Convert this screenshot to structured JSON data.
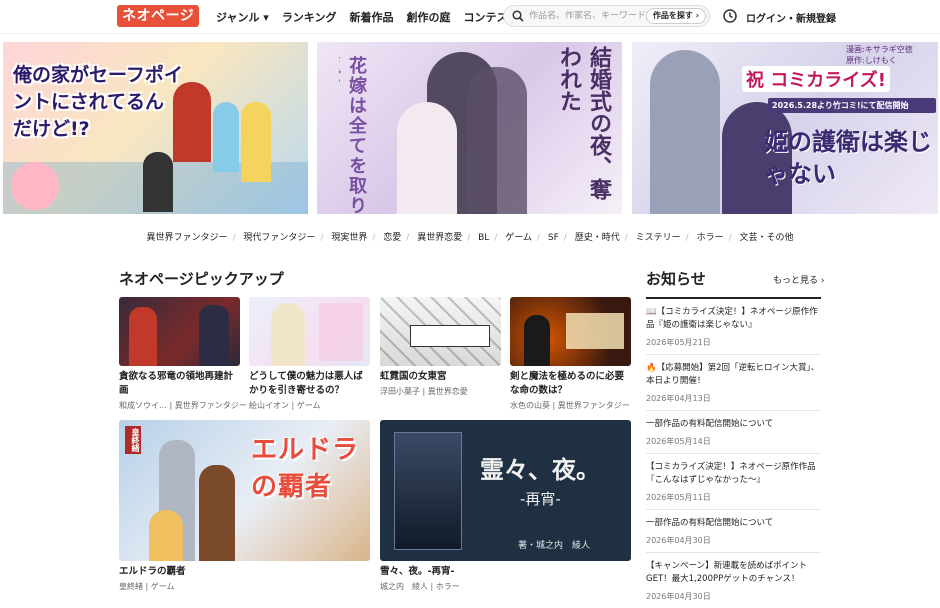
{
  "header": {
    "logo": "ネオページ",
    "nav": [
      "ジャンル ▾",
      "ランキング",
      "新着作品",
      "創作の庭",
      "コンテスト"
    ],
    "search_placeholder": "作品名、作家名、キーワードで探す",
    "search_button": "作品を探す ›",
    "login": "ログイン・新規登録"
  },
  "banners": [
    {
      "title": "俺の家がセーフポイントにされてるんだけど!?"
    },
    {
      "title": "花嫁は全てを取り返す",
      "subtitle": "結婚式の夜、奪われた"
    },
    {
      "title": "姫の護衛は楽じゃない",
      "badge": "祝 コミカライズ!",
      "note": "2026.5.28より竹コミ!にて配信開始",
      "credit_art": "漫画:キサラギ空徳",
      "credit_orig": "原作:しけもく"
    }
  ],
  "genres": [
    "異世界ファンタジー",
    "現代ファンタジー",
    "現実世界",
    "恋愛",
    "異世界恋愛",
    "BL",
    "ゲーム",
    "SF",
    "歴史・時代",
    "ミステリー",
    "ホラー",
    "文芸・その他"
  ],
  "pickup": {
    "title": "ネオページピックアップ",
    "small": [
      {
        "title": "貪欲なる邪竜の領地再建計画",
        "meta": "和成ソウイ… | 異世界ファンタジー"
      },
      {
        "title": "どうして僕の魅力は悪人ばかりを引き寄せるの？",
        "meta": "絵山イオン | ゲーム"
      },
      {
        "title": "虹霓国の女東宮",
        "meta": "浮田小葉子 | 異世界恋愛"
      },
      {
        "title": "剣と魔法を極めるのに必要な命の数は？",
        "meta": "水色の山葵 | 異世界ファンタジー"
      }
    ],
    "big": [
      {
        "title": "エルドラの覇者",
        "meta": "皇終緒 | ゲーム",
        "cover_text": "エルドラの覇者",
        "badge": "皇終緒"
      },
      {
        "title": "雪々、夜。-再宵-",
        "meta": "城之内　綾人 | ホラー",
        "cover_text": "霊々、夜。",
        "cover_sub": "-再宵-",
        "cover_author": "著・城之内　綾人"
      }
    ]
  },
  "notices": {
    "title": "お知らせ",
    "more": "もっと見る ›",
    "items": [
      {
        "text": "📖【コミカライズ決定！】ネオページ原作作品『姫の護衛は楽じゃない』",
        "date": "2026年05月21日"
      },
      {
        "text": "🔥【応募開始】第2回「逆転ヒロイン大賞」、本日より開催！",
        "date": "2026年04月13日"
      },
      {
        "text": "一部作品の有料配信開始について",
        "date": "2026年05月14日"
      },
      {
        "text": "【コミカライズ決定！】ネオページ原作作品『こんなはずじゃなかった〜』",
        "date": "2026年05月11日"
      },
      {
        "text": "一部作品の有料配信開始について",
        "date": "2026年04月30日"
      },
      {
        "text": "【キャンペーン】新連載を読めばポイントGET！最大1,200PPゲットのチャンス！",
        "date": "2026年04月30日"
      }
    ]
  }
}
